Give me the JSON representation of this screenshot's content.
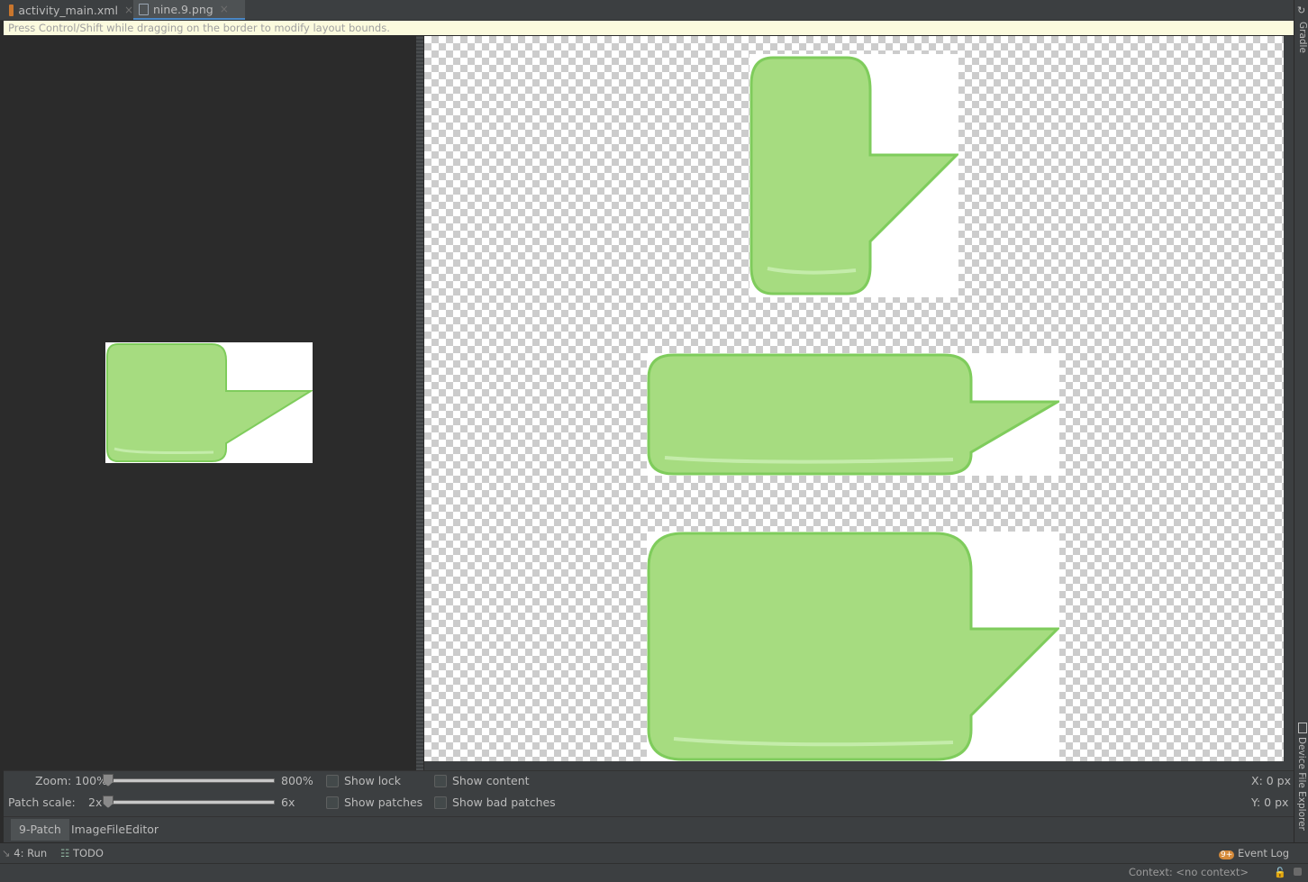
{
  "tabs": [
    {
      "label": "activity_main.xml",
      "icon": "xml-file-icon",
      "close": "×"
    },
    {
      "label": "nine.9.png",
      "icon": "image-file-icon",
      "close": "×"
    }
  ],
  "hint": "Press Control/Shift while dragging on the border to modify layout bounds.",
  "right_strip": {
    "gradle": "Gradle",
    "device_file_explorer": "Device File Explorer"
  },
  "controls": {
    "zoom_label": "Zoom: 100%",
    "zoom_max": "800%",
    "patch_scale_label": "Patch scale:",
    "patch_scale_value": "2x",
    "patch_scale_max": "6x",
    "show_lock": "Show lock",
    "show_patches": "Show patches",
    "show_content": "Show content",
    "show_bad_patches": "Show bad patches",
    "x_readout": "X: 0 px",
    "y_readout": "Y: 0 px"
  },
  "editor_tabs": [
    "9-Patch",
    "ImageFileEditor"
  ],
  "tool_windows": {
    "run": "4: Run",
    "todo": "TODO",
    "event_log": "Event Log",
    "event_count": "9+"
  },
  "status": {
    "context": "Context: <no context>"
  },
  "colors": {
    "bubble_fill": "#a6dc80",
    "bubble_edge": "#7fcc5c",
    "accent": "#4a88c7"
  }
}
